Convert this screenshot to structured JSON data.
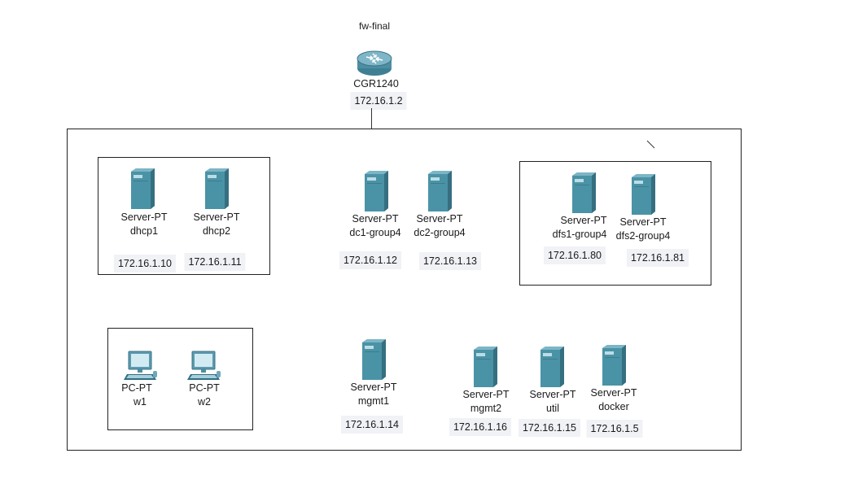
{
  "router": {
    "note": "fw-final",
    "model": "CGR1240",
    "ip": "172.16.1.2",
    "icon": "router-icon"
  },
  "servers": [
    {
      "id": "dhcp1",
      "type": "Server-PT",
      "name": "dhcp1",
      "ip": "172.16.1.10",
      "icon": "server-icon"
    },
    {
      "id": "dhcp2",
      "type": "Server-PT",
      "name": "dhcp2",
      "ip": "172.16.1.11",
      "icon": "server-icon"
    },
    {
      "id": "dc1",
      "type": "Server-PT",
      "name": "dc1-group4",
      "ip": "172.16.1.12",
      "icon": "server-icon"
    },
    {
      "id": "dc2",
      "type": "Server-PT",
      "name": "dc2-group4",
      "ip": "172.16.1.13",
      "icon": "server-icon"
    },
    {
      "id": "dfs1",
      "type": "Server-PT",
      "name": "dfs1-group4",
      "ip": "172.16.1.80",
      "icon": "server-icon"
    },
    {
      "id": "dfs2",
      "type": "Server-PT",
      "name": "dfs2-group4",
      "ip": "172.16.1.81",
      "icon": "server-icon"
    },
    {
      "id": "mgmt1",
      "type": "Server-PT",
      "name": "mgmt1",
      "ip": "172.16.1.14",
      "icon": "server-icon"
    },
    {
      "id": "mgmt2",
      "type": "Server-PT",
      "name": "mgmt2",
      "ip": "172.16.1.16",
      "icon": "server-icon"
    },
    {
      "id": "util",
      "type": "Server-PT",
      "name": "util",
      "ip": "172.16.1.15",
      "icon": "server-icon"
    },
    {
      "id": "docker",
      "type": "Server-PT",
      "name": "docker",
      "ip": "172.16.1.5",
      "icon": "server-icon"
    }
  ],
  "pcs": [
    {
      "id": "w1",
      "type": "PC-PT",
      "name": "w1",
      "icon": "pc-icon"
    },
    {
      "id": "w2",
      "type": "PC-PT",
      "name": "w2",
      "icon": "pc-icon"
    }
  ],
  "colors": {
    "server_face": "#4a93a6",
    "server_side": "#3a7a8b",
    "router_body": "#5b98ad",
    "ip_background": "#f1f2f6",
    "outline": "#222222"
  }
}
